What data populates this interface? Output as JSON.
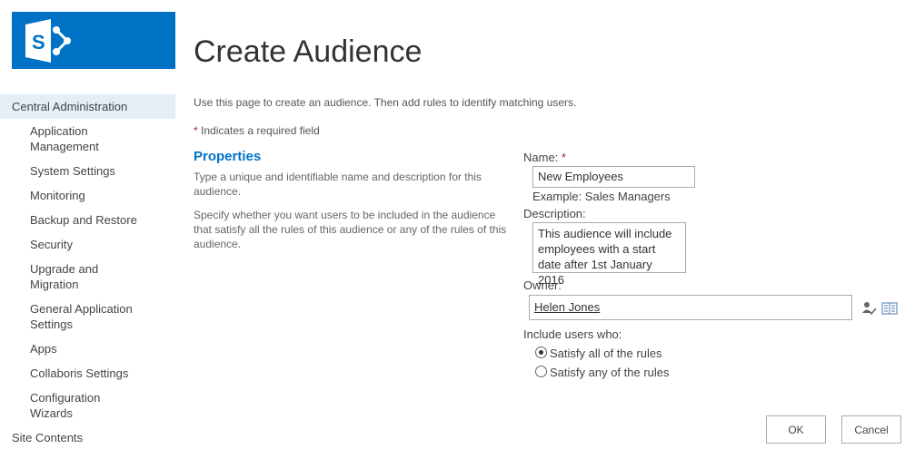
{
  "brand": {
    "icon": "sharepoint-logo-icon",
    "color": "#0072c6"
  },
  "nav": {
    "items": [
      {
        "label": "Central Administration",
        "level": 0,
        "selected": true
      },
      {
        "label": "Application Management",
        "level": 1
      },
      {
        "label": "System Settings",
        "level": 1
      },
      {
        "label": "Monitoring",
        "level": 1
      },
      {
        "label": "Backup and Restore",
        "level": 1
      },
      {
        "label": "Security",
        "level": 1
      },
      {
        "label": "Upgrade and Migration",
        "level": 1
      },
      {
        "label": "General Application Settings",
        "level": 1
      },
      {
        "label": "Apps",
        "level": 1
      },
      {
        "label": "Collaboris Settings",
        "level": 1
      },
      {
        "label": "Configuration Wizards",
        "level": 1
      },
      {
        "label": "Site Contents",
        "level": 0
      }
    ]
  },
  "page": {
    "title": "Create Audience",
    "intro": "Use this page to create an audience. Then add rules to identify matching users.",
    "required_star": "*",
    "required_note": " Indicates a required field"
  },
  "section": {
    "heading": "Properties",
    "desc1": "Type a unique and identifiable name and description for this audience.",
    "desc2": "Specify whether you want users to be included in the audience that satisfy all the rules of this audience or any of the rules of this audience."
  },
  "form": {
    "name_label": "Name:",
    "name_star": "*",
    "name_value": "New Employees",
    "name_example": "Example: Sales Managers",
    "description_label": "Description:",
    "description_value": "This audience will include employees with a start date after 1st January 2016",
    "owner_label": "Owner:",
    "owner_value": "Helen Jones",
    "include_label": "Include users who:",
    "options": [
      {
        "label": "Satisfy all of the rules",
        "checked": true
      },
      {
        "label": "Satisfy any of the rules",
        "checked": false
      }
    ]
  },
  "buttons": {
    "ok": "OK",
    "cancel": "Cancel"
  }
}
